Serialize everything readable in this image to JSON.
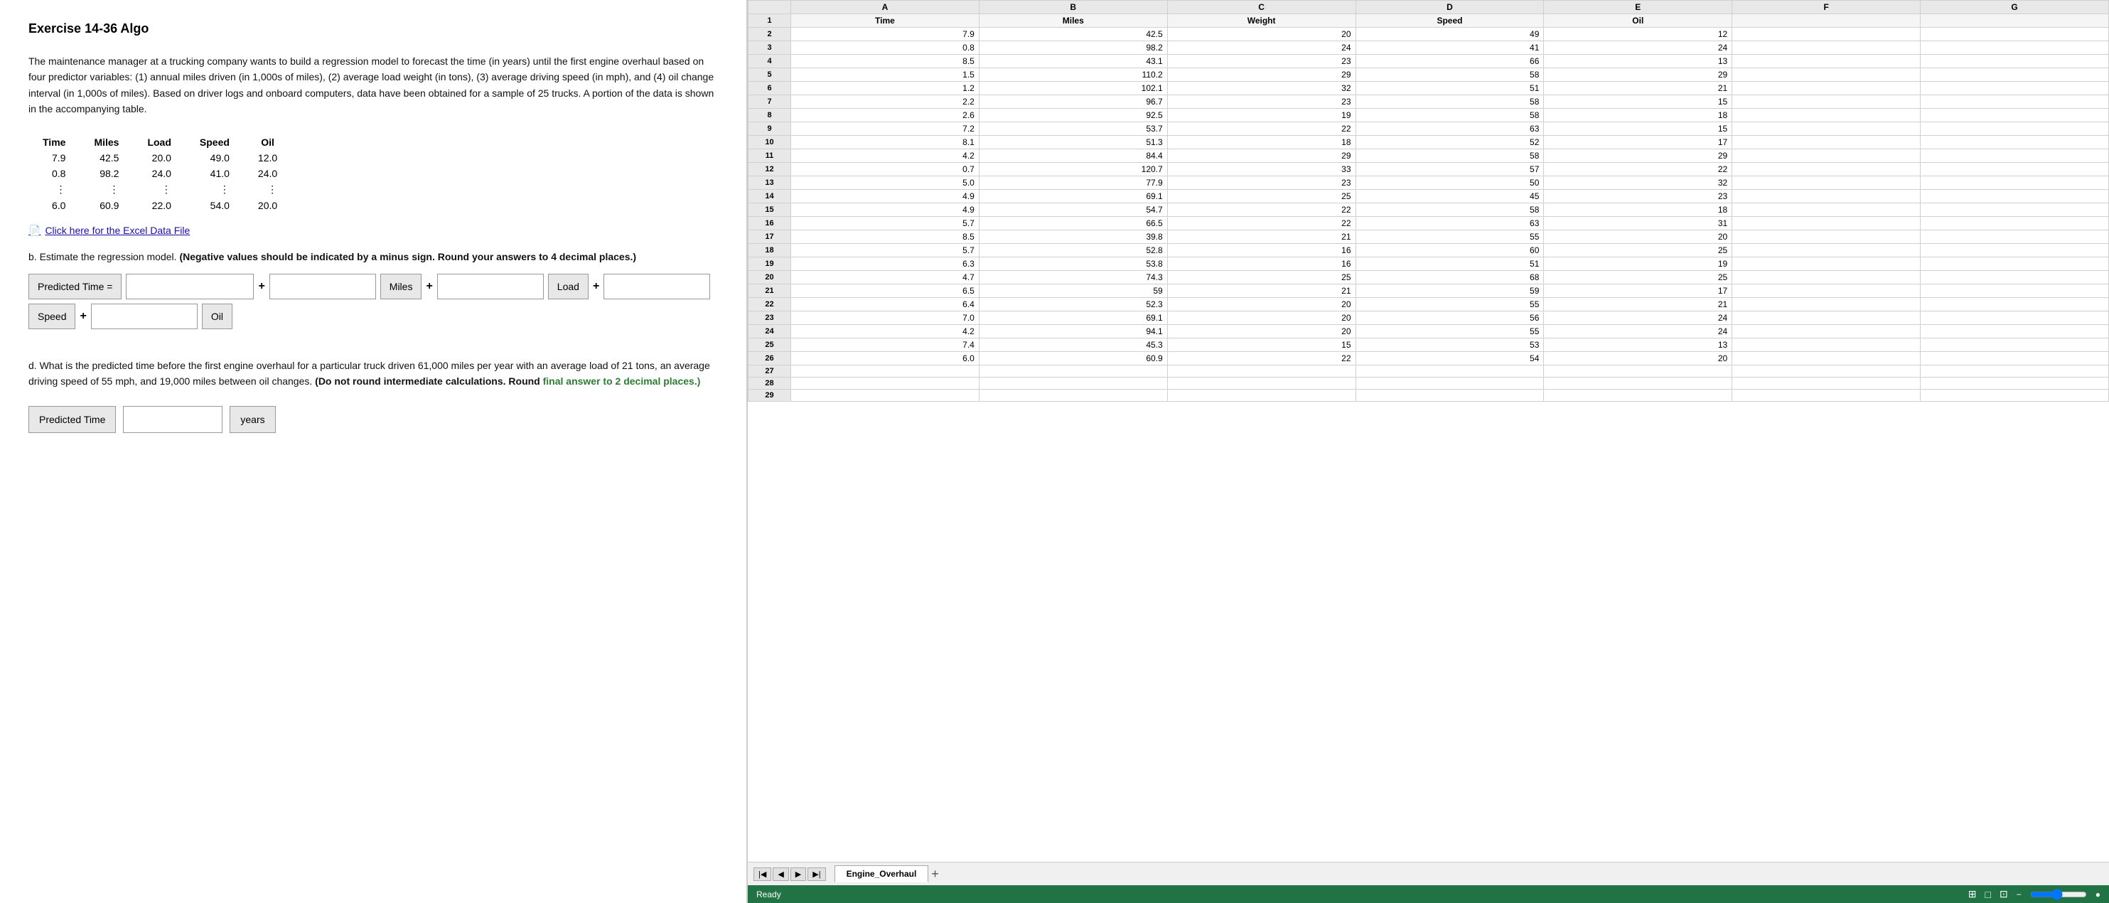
{
  "exercise": {
    "title": "Exercise 14-36 Algo",
    "description": "The maintenance manager at a trucking company wants to build a regression model to forecast the time (in years) until the first engine overhaul based on four predictor variables: (1) annual miles driven (in 1,000s of miles), (2) average load weight (in tons), (3) average driving speed (in mph), and (4) oil change interval (in 1,000s of miles). Based on driver logs and onboard computers, data have been obtained for a sample of 25 trucks. A portion of the data is shown in the accompanying table.",
    "excel_link": "Click here for the Excel Data File",
    "part_b_label": "b. Estimate the regression model.",
    "part_b_note": "(Negative values should be indicated by a minus sign. Round your answers to 4 decimal places.)",
    "regression_labels": {
      "predicted_time": "Predicted Time =",
      "miles": "Miles",
      "load": "Load",
      "speed": "Speed",
      "oil": "Oil",
      "plus": "+"
    },
    "part_d_text": "d. What is the predicted time before the first engine overhaul for a particular truck driven 61,000 miles per year with an average load of 21 tons, an average driving speed of 55 mph, and 19,000 miles between oil changes.",
    "part_d_note": "(Do not round intermediate calculations. Round final answer to 2 decimal places.)",
    "predicted_time_label": "Predicted Time",
    "years_label": "years",
    "table": {
      "headers": [
        "Time",
        "Miles",
        "Load",
        "Speed",
        "Oil"
      ],
      "rows": [
        [
          "7.9",
          "42.5",
          "20.0",
          "49.0",
          "12.0"
        ],
        [
          "0.8",
          "98.2",
          "24.0",
          "41.0",
          "24.0"
        ],
        [
          ":",
          ":",
          ":",
          ":",
          ":"
        ],
        [
          "6.0",
          "60.9",
          "22.0",
          "54.0",
          "20.0"
        ]
      ]
    }
  },
  "spreadsheet": {
    "col_headers": [
      "",
      "A",
      "B",
      "C",
      "D",
      "E",
      "F",
      "G"
    ],
    "rows": [
      {
        "row": 1,
        "cells": [
          "Time",
          "Miles",
          "Weight",
          "Speed",
          "Oil",
          "",
          ""
        ]
      },
      {
        "row": 2,
        "cells": [
          "7.9",
          "42.5",
          "20",
          "49",
          "12",
          "",
          ""
        ]
      },
      {
        "row": 3,
        "cells": [
          "0.8",
          "98.2",
          "24",
          "41",
          "24",
          "",
          ""
        ]
      },
      {
        "row": 4,
        "cells": [
          "8.5",
          "43.1",
          "23",
          "66",
          "13",
          "",
          ""
        ]
      },
      {
        "row": 5,
        "cells": [
          "1.5",
          "110.2",
          "29",
          "58",
          "29",
          "",
          ""
        ]
      },
      {
        "row": 6,
        "cells": [
          "1.2",
          "102.1",
          "32",
          "51",
          "21",
          "",
          ""
        ]
      },
      {
        "row": 7,
        "cells": [
          "2.2",
          "96.7",
          "23",
          "58",
          "15",
          "",
          ""
        ]
      },
      {
        "row": 8,
        "cells": [
          "2.6",
          "92.5",
          "19",
          "58",
          "18",
          "",
          ""
        ]
      },
      {
        "row": 9,
        "cells": [
          "7.2",
          "53.7",
          "22",
          "63",
          "15",
          "",
          ""
        ]
      },
      {
        "row": 10,
        "cells": [
          "8.1",
          "51.3",
          "18",
          "52",
          "17",
          "",
          ""
        ]
      },
      {
        "row": 11,
        "cells": [
          "4.2",
          "84.4",
          "29",
          "58",
          "29",
          "",
          ""
        ]
      },
      {
        "row": 12,
        "cells": [
          "0.7",
          "120.7",
          "33",
          "57",
          "22",
          "",
          ""
        ]
      },
      {
        "row": 13,
        "cells": [
          "5.0",
          "77.9",
          "23",
          "50",
          "32",
          "",
          ""
        ]
      },
      {
        "row": 14,
        "cells": [
          "4.9",
          "69.1",
          "25",
          "45",
          "23",
          "",
          ""
        ]
      },
      {
        "row": 15,
        "cells": [
          "4.9",
          "54.7",
          "22",
          "58",
          "18",
          "",
          ""
        ]
      },
      {
        "row": 16,
        "cells": [
          "5.7",
          "66.5",
          "22",
          "63",
          "31",
          "",
          ""
        ]
      },
      {
        "row": 17,
        "cells": [
          "8.5",
          "39.8",
          "21",
          "55",
          "20",
          "",
          ""
        ]
      },
      {
        "row": 18,
        "cells": [
          "5.7",
          "52.8",
          "16",
          "60",
          "25",
          "",
          ""
        ]
      },
      {
        "row": 19,
        "cells": [
          "6.3",
          "53.8",
          "16",
          "51",
          "19",
          "",
          ""
        ]
      },
      {
        "row": 20,
        "cells": [
          "4.7",
          "74.3",
          "25",
          "68",
          "25",
          "",
          ""
        ]
      },
      {
        "row": 21,
        "cells": [
          "6.5",
          "59",
          "21",
          "59",
          "17",
          "",
          ""
        ]
      },
      {
        "row": 22,
        "cells": [
          "6.4",
          "52.3",
          "20",
          "55",
          "21",
          "",
          ""
        ]
      },
      {
        "row": 23,
        "cells": [
          "7.0",
          "69.1",
          "20",
          "56",
          "24",
          "",
          ""
        ]
      },
      {
        "row": 24,
        "cells": [
          "4.2",
          "94.1",
          "20",
          "55",
          "24",
          "",
          ""
        ]
      },
      {
        "row": 25,
        "cells": [
          "7.4",
          "45.3",
          "15",
          "53",
          "13",
          "",
          ""
        ]
      },
      {
        "row": 26,
        "cells": [
          "6.0",
          "60.9",
          "22",
          "54",
          "20",
          "",
          ""
        ]
      },
      {
        "row": 27,
        "cells": [
          "",
          "",
          "",
          "",
          "",
          "",
          ""
        ]
      },
      {
        "row": 28,
        "cells": [
          "",
          "",
          "",
          "",
          "",
          "",
          ""
        ]
      },
      {
        "row": 29,
        "cells": [
          "",
          "",
          "",
          "",
          "",
          "",
          ""
        ]
      }
    ],
    "sheet_name": "Engine_Overhaul",
    "status": "Ready"
  }
}
